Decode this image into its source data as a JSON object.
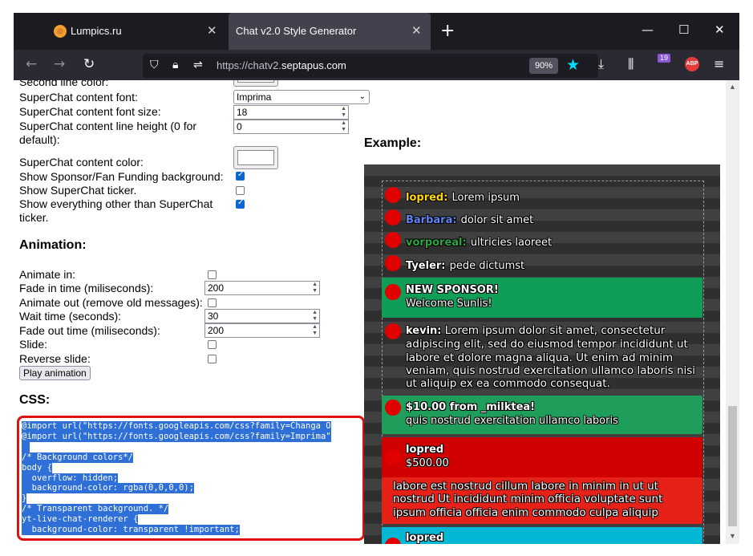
{
  "browser": {
    "tabs": [
      {
        "label": "Lumpics.ru"
      },
      {
        "label": "Chat v2.0 Style Generator"
      }
    ],
    "url_scheme": "https://chatv2.",
    "url_host": "septapus.com",
    "zoom": "90%",
    "library_badge": "19",
    "abp_label": "ABP"
  },
  "form": {
    "second_line_color_label": "Second line color:",
    "sc_font_label": "SuperChat content font:",
    "sc_font_value": "Imprima",
    "sc_font_size_label": "SuperChat content font size:",
    "sc_font_size_value": "18",
    "sc_line_height_label": "SuperChat content line height (0 for",
    "sc_line_height_label2": "default):",
    "sc_line_height_value": "0",
    "sc_color_label": "SuperChat content color:",
    "show_sponsor_label": "Show Sponsor/Fan Funding background:",
    "show_ticker_label": "Show SuperChat ticker.",
    "show_everything_label": "Show everything other than SuperChat",
    "show_everything_label2": "ticker.",
    "animation_heading": "Animation:",
    "animate_in_label": "Animate in:",
    "fade_in_label": "Fade in time (miliseconds):",
    "fade_in_value": "200",
    "animate_out_label": "Animate out (remove old messages):",
    "wait_label": "Wait time (seconds):",
    "wait_value": "30",
    "fade_out_label": "Fade out time (miliseconds):",
    "fade_out_value": "200",
    "slide_label": "Slide:",
    "reverse_slide_label": "Reverse slide:",
    "play_button": "Play animation",
    "css_heading": "CSS:"
  },
  "css_lines": {
    "l1": "@import url(\"https://fonts.googleapis.com/css?family=Changa O",
    "l2": "@import url(\"https://fonts.googleapis.com/css?family=Imprima\"",
    "l4": "/* Background colors*/",
    "l5": "body {",
    "l6": "  overflow: hidden;",
    "l7": "  background-color: rgba(0,0,0,0);",
    "l8": "}",
    "l9": "/* Transparent background. */",
    "l10": "yt-live-chat-renderer {",
    "l11": "  background-color: transparent !important;"
  },
  "example": {
    "heading": "Example:",
    "messages": [
      {
        "author": "lopred:",
        "text": "Lorem ipsum",
        "color": "#ffd600"
      },
      {
        "author": "Barbara:",
        "text": "dolor sit amet",
        "color": "#5e84f1"
      },
      {
        "author": "vorporeal:",
        "text": "ultricies laoreet",
        "color": "#2ba640"
      },
      {
        "author": "Tyeler:",
        "text": "pede dictumst",
        "color": "#ffffff"
      }
    ],
    "sponsor": {
      "title": "NEW SPONSOR!",
      "text": "Welcome Sunlis!",
      "color": "#0f9d58"
    },
    "kevin": {
      "author": "kevin:",
      "text": "Lorem ipsum dolor sit amet, consectetur adipiscing elit, sed do eiusmod tempor incididunt ut labore et dolore magna aliqua. Ut enim ad minim veniam, quis nostrud exercitation ullamco laboris nisi ut aliquip ex ea commodo consequat."
    },
    "superchat1": {
      "header": "$10.00 from _milktea!",
      "text": "quis nostrud exercitation ullamco laboris",
      "color": "#1e9e5a"
    },
    "superchat2": {
      "author": "lopred",
      "amount": "$500.00",
      "text": "labore est nostrud cillum labore in minim in ut ut nostrud Ut incididunt minim officia voluptate sunt ipsum officia officia enim commodo culpa aliquip",
      "header_color": "#d00000",
      "body_color": "#e62117"
    },
    "superchat3": {
      "author": "lopred",
      "color": "#00b8d4"
    }
  }
}
